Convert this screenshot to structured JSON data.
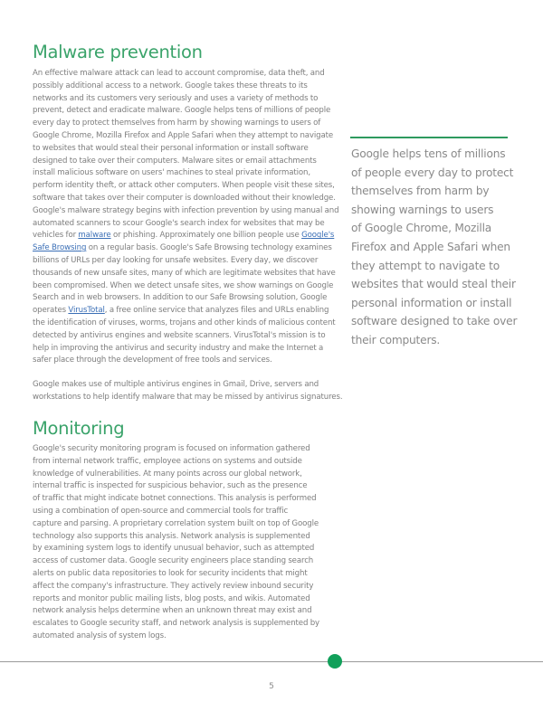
{
  "malware": {
    "title": "Malware prevention",
    "lines": [
      "An effective malware attack can lead to account compromise, data theft, and",
      "possibly additional access to a network. Google takes these threats to its",
      "networks and its customers very seriously and uses a variety of methods to",
      "prevent, detect and eradicate malware. Google helps tens of millions of people",
      "every day to protect themselves from harm by showing warnings to users of",
      "Google Chrome, Mozilla Firefox and Apple Safari when they attempt to navigate",
      "to websites that would steal their personal information or install software",
      "designed to take over their computers. Malware sites or email attachments",
      "install malicious software on users' machines to steal private information,",
      "perform identity theft, or attack other computers. When people visit these sites,",
      "software that takes over their computer is downloaded without their knowledge.",
      "Google's malware strategy begins with infection prevention by using manual and",
      "automated scanners to scour Google's search index for websites that may be"
    ],
    "line14_pre": "vehicles for ",
    "link_malware": "malware",
    "line14_mid": " or phishing. Approximately one billion people use ",
    "link_safe_browsing_1": "Google's",
    "link_safe_browsing_2": "Safe Browsing",
    "line15_post": " on a regular basis. Google's Safe Browsing technology examines",
    "lines_b": [
      "billions of URLs per day looking for unsafe websites. Every day, we discover",
      "thousands of new unsafe sites, many of which are legitimate websites that have",
      "been compromised. When we detect unsafe sites, we show warnings on Google",
      "Search and in web browsers. In addition to our Safe Browsing solution, Google"
    ],
    "line20_pre": "operates ",
    "link_virustotal": "VirusTotal",
    "line20_post": ", a free online service that analyzes files and URLs enabling",
    "lines_c": [
      "the identification of viruses, worms, trojans and other kinds of malicious content",
      "detected by antivirus engines and website scanners. VirusTotal's mission is to",
      "help in improving the antivirus and security industry and make the Internet a",
      "safer place through the development of free tools and services."
    ],
    "paragraph2": [
      "Google makes use of multiple antivirus engines in Gmail, Drive, servers and",
      "workstations to help identify malware that may be missed by antivirus signatures."
    ]
  },
  "pull_quote": {
    "lines": [
      "Google helps tens of millions",
      "of people every day to protect",
      "themselves from harm by",
      "showing warnings to users",
      "of Google Chrome, Mozilla",
      "Firefox and Apple Safari when",
      "they attempt to navigate to",
      "websites that would steal their",
      "personal information or install",
      "software designed to take over",
      "their computers."
    ]
  },
  "monitoring": {
    "title": "Monitoring",
    "lines": [
      "Google's security monitoring program is focused on information gathered",
      "from internal network traffic, employee actions on systems and outside",
      "knowledge of vulnerabilities. At many points across our global network,",
      "internal traffic is inspected for suspicious behavior, such as the presence",
      "of traffic that might indicate botnet connections. This analysis is performed",
      "using a combination of open-source and commercial tools for traffic",
      "capture and parsing. A proprietary correlation system built on top of Google",
      "technology also supports this analysis. Network analysis is supplemented",
      "by examining system logs to identify unusual behavior, such as attempted",
      "access of customer data. Google security engineers place standing search",
      "alerts on public data repositories to look for security incidents that might",
      "affect the company's infrastructure. They actively review inbound security",
      "reports and monitor public mailing lists, blog posts, and wikis. Automated",
      "network analysis helps determine when an unknown threat may exist and",
      "escalates to Google security staff, and network analysis is supplemented by",
      "automated analysis of system logs."
    ]
  },
  "footer": {
    "page_number": "5",
    "accent_color": "#11a05a"
  }
}
